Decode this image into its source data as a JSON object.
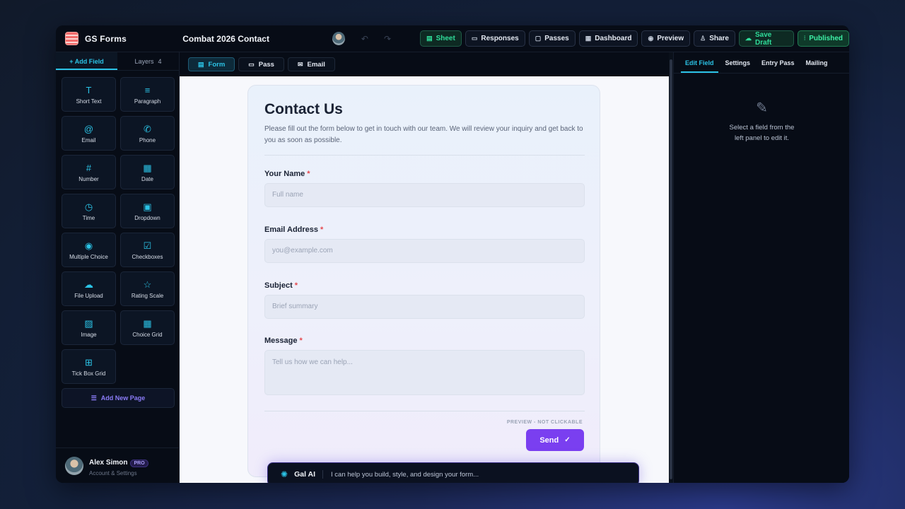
{
  "app": {
    "name": "GS Forms"
  },
  "toolbar": {
    "form_title": "Combat 2026 Contact",
    "undo_icon": "↶",
    "redo_icon": "↷",
    "buttons": {
      "sheet": "Sheet",
      "responses": "Responses",
      "passes": "Passes",
      "dashboard": "Dashboard",
      "preview": "Preview",
      "share": "Share",
      "save_draft": "Save Draft",
      "published": "Published"
    }
  },
  "sidebar": {
    "tab_add": "+ Add Field",
    "tab_layers": "Layers",
    "layers_count": "4",
    "fields": [
      {
        "label": "Short Text",
        "icon": "T"
      },
      {
        "label": "Paragraph",
        "icon": "≡"
      },
      {
        "label": "Email",
        "icon": "@"
      },
      {
        "label": "Phone",
        "icon": "✆"
      },
      {
        "label": "Number",
        "icon": "#"
      },
      {
        "label": "Date",
        "icon": "▦"
      },
      {
        "label": "Time",
        "icon": "◷"
      },
      {
        "label": "Dropdown",
        "icon": "▣"
      },
      {
        "label": "Multiple Choice",
        "icon": "◉"
      },
      {
        "label": "Checkboxes",
        "icon": "☑"
      },
      {
        "label": "File Upload",
        "icon": "☁"
      },
      {
        "label": "Rating Scale",
        "icon": "☆"
      },
      {
        "label": "Image",
        "icon": "▨"
      },
      {
        "label": "Choice Grid",
        "icon": "▦"
      },
      {
        "label": "Tick Box Grid",
        "icon": "⊞"
      }
    ],
    "add_page": "Add New Page",
    "user": {
      "name": "Alex Simon",
      "badge": "PRO",
      "subtitle": "Account & Settings"
    }
  },
  "center": {
    "tabs": {
      "form": "Form",
      "pass": "Pass",
      "email": "Email"
    }
  },
  "form": {
    "title": "Contact Us",
    "description": "Please fill out the form below to get in touch with our team. We will review your inquiry and get back to you as soon as possible.",
    "fields": {
      "name": {
        "label": "Your Name",
        "placeholder": "Full name"
      },
      "email": {
        "label": "Email Address",
        "placeholder": "you@example.com"
      },
      "subject": {
        "label": "Subject",
        "placeholder": "Brief summary"
      },
      "message": {
        "label": "Message",
        "placeholder": "Tell us how we can help..."
      }
    },
    "required_mark": "*",
    "preview_note": "PREVIEW - NOT CLICKABLE",
    "submit": "Send"
  },
  "ai": {
    "name": "Gal AI",
    "prompt": "I can help you build, style, and design your form..."
  },
  "right_panel": {
    "tabs": {
      "edit_field": "Edit Field",
      "settings": "Settings",
      "entry_pass": "Entry Pass",
      "mailing": "Mailing"
    },
    "empty_line1": "Select a field from the",
    "empty_line2": "left panel to edit it."
  },
  "colors": {
    "accent": "#2bc3e6",
    "green": "#2fdd9a",
    "purple": "#7a3ff0"
  }
}
